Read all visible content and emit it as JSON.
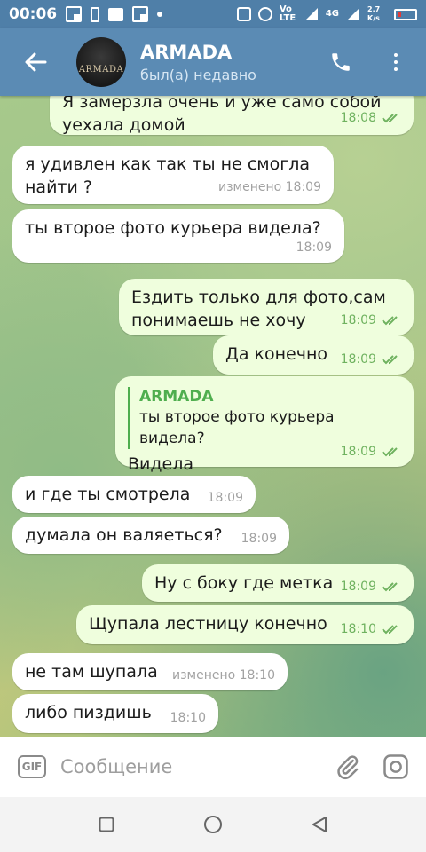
{
  "status_bar": {
    "time": "00:06",
    "volte": "Vo LTE",
    "network": "4G",
    "speed": "2.7 K/s"
  },
  "header": {
    "back_icon": "arrow-left-icon",
    "avatar_text": "ARMADA",
    "title": "ARMADA",
    "subtitle": "был(а) недавно",
    "call_icon": "phone-icon",
    "menu_icon": "more-vertical-icon"
  },
  "colors": {
    "header": "#5b8bb4",
    "incoming_bubble": "#ffffff",
    "outgoing_bubble": "#effedd",
    "check_color": "#6fb25f",
    "reply_accent": "#4fae4e"
  },
  "messages": [
    {
      "dir": "out",
      "text": "Я замерзла очень и уже само собой уехала домой",
      "time": "18:08",
      "read": true
    },
    {
      "dir": "in",
      "text": "я удивлен как так ты не смогла найти ?",
      "time": "изменено 18:09"
    },
    {
      "dir": "in",
      "text": "ты второе фото курьера видела?",
      "time": "18:09"
    },
    {
      "dir": "out",
      "text": "Ездить только для фото,сам понимаешь не хочу",
      "time": "18:09",
      "read": true
    },
    {
      "dir": "out",
      "text": "Да конечно",
      "time": "18:09",
      "read": true
    },
    {
      "dir": "out",
      "reply_name": "ARMADA",
      "reply_text": "ты второе фото курьера видела?",
      "text": "Видела",
      "time": "18:09",
      "read": true
    },
    {
      "dir": "in",
      "text": "и где ты смотрела",
      "time": "18:09"
    },
    {
      "dir": "in",
      "text": "думала он валяеться?",
      "time": "18:09"
    },
    {
      "dir": "out",
      "text": "Ну с боку где метка",
      "time": "18:09",
      "read": true
    },
    {
      "dir": "out",
      "text": "Щупала лестницу конечно",
      "time": "18:10",
      "read": true
    },
    {
      "dir": "in",
      "text": "не там шупала",
      "time": "изменено 18:10"
    },
    {
      "dir": "in",
      "text": "либо пиздишь",
      "time": "18:10"
    }
  ],
  "input": {
    "gif_label": "GIF",
    "placeholder": "Сообщение",
    "attach_icon": "paperclip-icon",
    "camera_icon": "camera-icon"
  },
  "nav": {
    "recents_icon": "square-icon",
    "home_icon": "circle-icon",
    "back_icon": "triangle-back-icon"
  }
}
